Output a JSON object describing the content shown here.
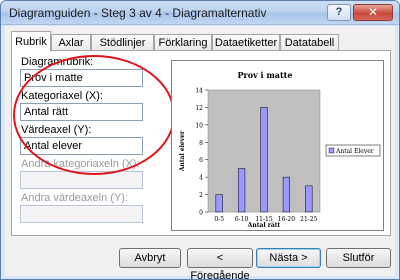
{
  "window": {
    "title": "Diagramguiden - Steg 3 av 4 - Diagramalternativ",
    "help_label": "?",
    "close_label": "✕"
  },
  "tabs": [
    {
      "label": "Rubrik",
      "active": true
    },
    {
      "label": "Axlar",
      "active": false
    },
    {
      "label": "Stödlinjer",
      "active": false
    },
    {
      "label": "Förklaring",
      "active": false
    },
    {
      "label": "Dataetiketter",
      "active": false
    },
    {
      "label": "Datatabell",
      "active": false
    }
  ],
  "form": {
    "chart_title_label": "Diagramrubrik:",
    "chart_title_value": "Prov i matte",
    "category_axis_label": "Kategoriaxel (X):",
    "category_axis_value": "Antal rätt",
    "value_axis_label": "Värdeaxel (Y):",
    "value_axis_value": "Antal elever",
    "second_category_axis_label": "Andra kategoriaxeln (X):",
    "second_category_axis_value": "",
    "second_value_axis_label": "Andra värdeaxeln (Y):",
    "second_value_axis_value": ""
  },
  "buttons": {
    "cancel": "Avbryt",
    "back": "< Föregående",
    "next": "Nästa >",
    "finish": "Slutför"
  },
  "colors": {
    "accent_ellipse": "#e0141d",
    "bar_fill": "#9999ff",
    "plot_area": "#c0c0c0"
  },
  "chart_data": {
    "type": "bar",
    "title": "Prov i matte",
    "xlabel": "Antal rätt",
    "ylabel": "Antal elever",
    "categories": [
      "0-5",
      "6-10",
      "11-15",
      "16-20",
      "21-25"
    ],
    "series": [
      {
        "name": "Antal Elever",
        "values": [
          2,
          5,
          12,
          4,
          3
        ]
      }
    ],
    "ylim": [
      0,
      14
    ],
    "yticks": [
      0,
      2,
      4,
      6,
      8,
      10,
      12,
      14
    ],
    "grid": false,
    "legend": "right"
  }
}
